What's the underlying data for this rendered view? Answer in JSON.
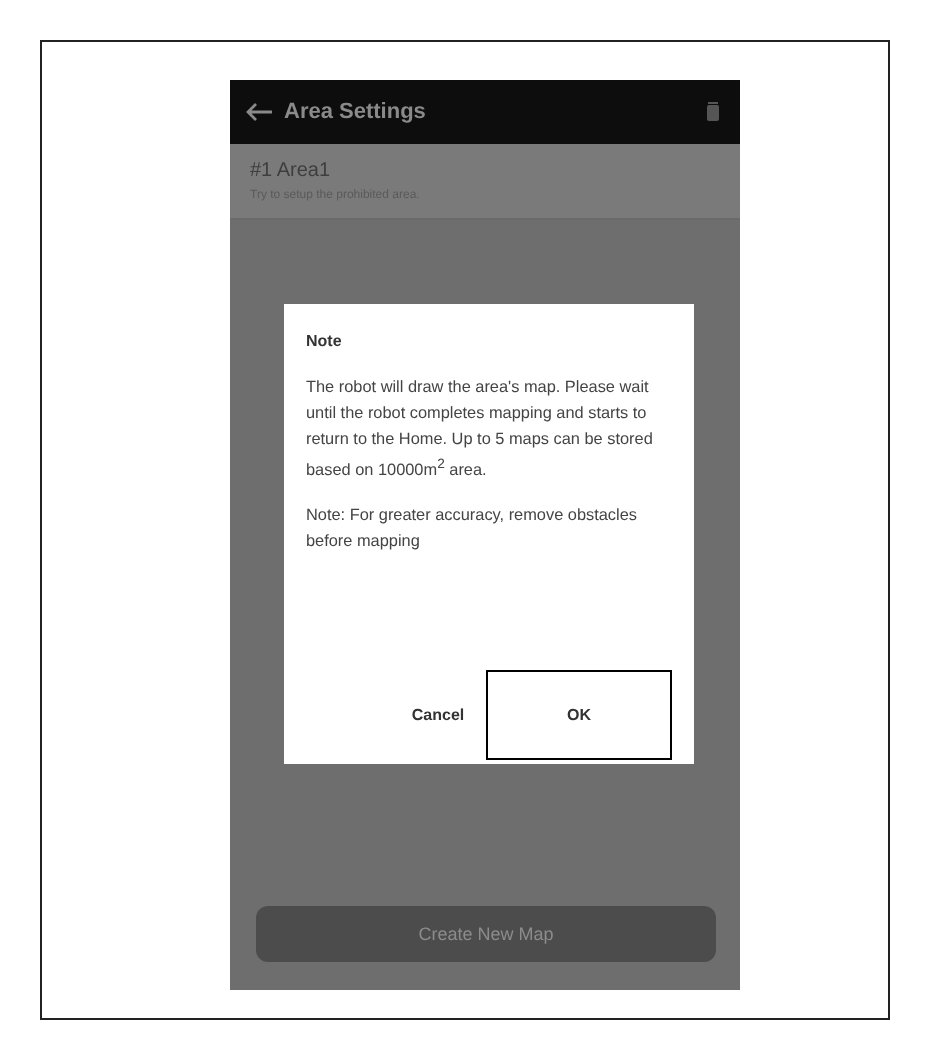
{
  "header": {
    "title": "Area Settings"
  },
  "area": {
    "name": "#1 Area1",
    "hint": "Try to setup the prohibited area."
  },
  "dialog": {
    "title": "Note",
    "paragraphs": [
      "The robot will draw the area's map. Please wait until the robot completes mapping and starts to return to the Home. Up to 5 maps can be stored based on 10000m$^{2}$ area.",
      "Note: For greater accuracy, remove obstacles before mapping"
    ],
    "buttons": [
      {
        "label": "Cancel",
        "highlighted": false
      },
      {
        "label": "OK",
        "highlighted": true
      }
    ]
  },
  "create_button": {
    "label": "Create New Map"
  }
}
